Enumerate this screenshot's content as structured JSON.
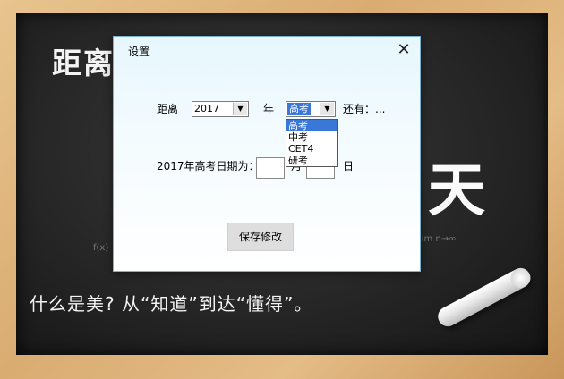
{
  "board": {
    "title": "距离",
    "big_text": "天",
    "quote": "什么是美? 从“知道”到达“懂得”。",
    "scribble_left": "f(x)",
    "scribble_right": "lim n→∞"
  },
  "dialog": {
    "title": "设置",
    "close_glyph": "✕",
    "distance_label": "距离",
    "year_combo": {
      "value": "2017"
    },
    "year_label": "年",
    "exam_combo": {
      "value": "高考",
      "options": [
        "高考",
        "中考",
        "CET4",
        "研考"
      ],
      "highlighted": "高考"
    },
    "remaining_label": "还有：...",
    "date_label": "2017年高考日期为：",
    "month_label": "月",
    "day_label": "日",
    "save_button": "保存修改"
  },
  "colors": {
    "selection": "#3a78d8",
    "dialog_border": "#7fb1cf"
  }
}
